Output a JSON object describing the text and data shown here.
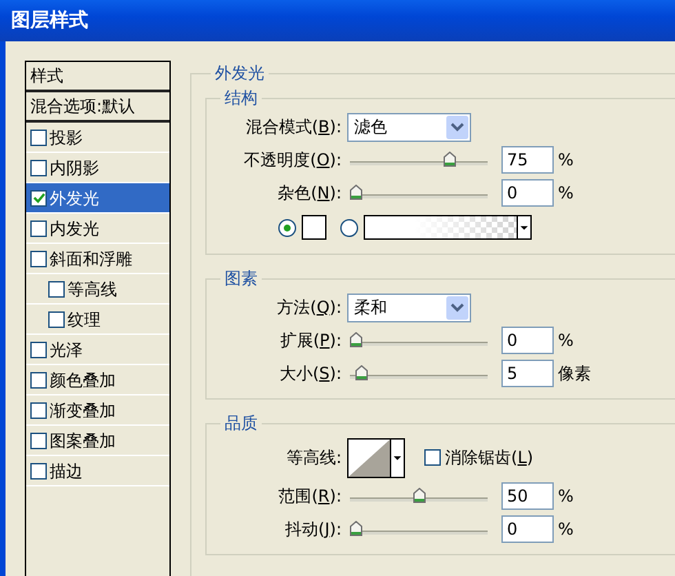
{
  "window": {
    "title": "图层样式"
  },
  "styles": [
    {
      "kind": "header",
      "label": "样式",
      "selected": false
    },
    {
      "kind": "blend",
      "label": "混合选项:默认",
      "selected": false
    },
    {
      "kind": "check",
      "label": "投影",
      "checked": false,
      "selected": false
    },
    {
      "kind": "check",
      "label": "内阴影",
      "checked": false,
      "selected": false
    },
    {
      "kind": "check",
      "label": "外发光",
      "checked": true,
      "selected": true
    },
    {
      "kind": "check",
      "label": "内发光",
      "checked": false,
      "selected": false
    },
    {
      "kind": "check",
      "label": "斜面和浮雕",
      "checked": false,
      "selected": false,
      "children": [
        {
          "kind": "check",
          "label": "等高线",
          "checked": false,
          "selected": false
        },
        {
          "kind": "check",
          "label": "纹理",
          "checked": false,
          "selected": false
        }
      ]
    },
    {
      "kind": "check",
      "label": "光泽",
      "checked": false,
      "selected": false
    },
    {
      "kind": "check",
      "label": "颜色叠加",
      "checked": false,
      "selected": false
    },
    {
      "kind": "check",
      "label": "渐变叠加",
      "checked": false,
      "selected": false
    },
    {
      "kind": "check",
      "label": "图案叠加",
      "checked": false,
      "selected": false
    },
    {
      "kind": "check",
      "label": "描边",
      "checked": false,
      "selected": false
    }
  ],
  "panel": {
    "title": "外发光",
    "groups": [
      {
        "title": "结构",
        "rows": [
          {
            "kind": "dropdown",
            "label_before": "混合模式(",
            "accel": "B",
            "label_after": "):",
            "value": "滤色"
          },
          {
            "kind": "slider",
            "label_before": "不透明度(",
            "accel": "O",
            "label_after": "):",
            "level": 0.75,
            "value": "75",
            "unit": "%"
          },
          {
            "kind": "slider",
            "label_before": "杂色(",
            "accel": "N",
            "label_after": "):",
            "level": 0,
            "value": "0",
            "unit": "%"
          },
          {
            "kind": "fill",
            "options": [
              {
                "kind": "color",
                "selected": true
              },
              {
                "kind": "gradient",
                "selected": false
              }
            ]
          }
        ]
      },
      {
        "title": "图素",
        "rows": [
          {
            "kind": "dropdown",
            "label_before": "方法(",
            "accel": "Q",
            "label_after": "):",
            "value": "柔和"
          },
          {
            "kind": "slider",
            "label_before": "扩展(",
            "accel": "P",
            "label_after": "):",
            "level": 0,
            "value": "0",
            "unit": "%"
          },
          {
            "kind": "slider",
            "label_before": "大小(",
            "accel": "S",
            "label_after": "):",
            "level": 0.04,
            "value": "5",
            "unit": "像素"
          }
        ]
      },
      {
        "title": "品质",
        "rows": [
          {
            "kind": "contour",
            "label": "等高线:",
            "checkbox": {
              "label_before": "消除锯齿(",
              "accel": "L",
              "label_after": ")",
              "checked": false
            }
          },
          {
            "kind": "slider",
            "label_before": "范围(",
            "accel": "R",
            "label_after": "):",
            "level": 0.5,
            "value": "50",
            "unit": "%"
          },
          {
            "kind": "slider",
            "label_before": "抖动(",
            "accel": "J",
            "label_after": "):",
            "level": 0,
            "value": "0",
            "unit": "%"
          }
        ]
      }
    ]
  }
}
